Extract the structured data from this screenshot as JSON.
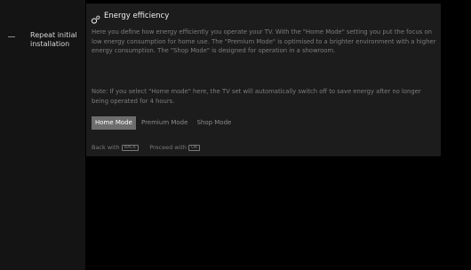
{
  "sidebar": {
    "item_label": "Repeat initial installation"
  },
  "panel": {
    "icon": "gear-icon",
    "title": "Energy efficiency",
    "description": "Here you define how energy efficiently you operate your TV. With the \"Home Mode\" setting you put the focus on low energy consumption for home use. The \"Premium Mode\" is optimised to a brighter environment with a higher energy consumption. The \"Shop Mode\" is designed for operation in a showroom.",
    "note": "Note: If you select \"Home mode\" here, the TV set will automatically switch off to save energy after no longer being operated for 4 hours.",
    "modes": [
      {
        "label": "Home Mode",
        "selected": true
      },
      {
        "label": "Premium Mode",
        "selected": false
      },
      {
        "label": "Shop Mode",
        "selected": false
      }
    ]
  },
  "footer": {
    "back_text": "Back with",
    "back_key": "BACK",
    "proceed_text": "Proceed with",
    "proceed_key": "OK"
  },
  "colors": {
    "background": "#000000",
    "panel": "#1c1c1c",
    "selected_mode": "#6d6d6d"
  }
}
